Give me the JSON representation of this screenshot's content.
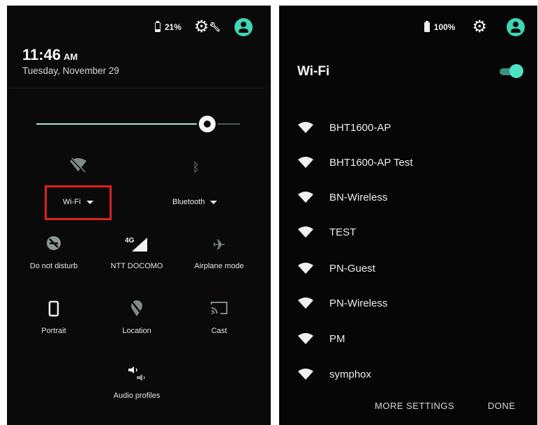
{
  "left_panel": {
    "status": {
      "battery_percent": "21%",
      "battery_level": 0.21
    },
    "clock": {
      "time": "11:46",
      "ampm": "AM"
    },
    "date": "Tuesday, November 29",
    "brightness_level": 0.84,
    "tiles": {
      "wifi": {
        "label": "Wi-Fi",
        "icon": "wifi-off-icon",
        "highlighted": true
      },
      "bluetooth": {
        "label": "Bluetooth",
        "icon": "bluetooth-off-icon"
      },
      "dnd": {
        "label": "Do not disturb",
        "icon": "do-not-disturb-icon"
      },
      "cellular": {
        "label": "NTT DOCOMO",
        "network_type": "4G",
        "icon": "signal-icon"
      },
      "airplane": {
        "label": "Airplane mode",
        "icon": "airplane-icon"
      },
      "rotation": {
        "label": "Portrait",
        "icon": "portrait-icon"
      },
      "location": {
        "label": "Location",
        "icon": "location-off-icon"
      },
      "cast": {
        "label": "Cast",
        "icon": "cast-icon"
      },
      "audio": {
        "label": "Audio profiles",
        "icon": "audio-profiles-icon"
      }
    },
    "colors": {
      "highlight_box": "#e02020",
      "accent": "#3dd6b8"
    }
  },
  "right_panel": {
    "status": {
      "battery_percent": "100%",
      "battery_level": 1.0
    },
    "title": "Wi-Fi",
    "wifi_enabled": true,
    "networks": [
      "BHT1600-AP",
      "BHT1600-AP Test",
      "BN-Wireless",
      "TEST",
      "PN-Guest",
      "PN-Wireless",
      "PM",
      "symphox"
    ],
    "actions": {
      "more_settings": "MORE SETTINGS",
      "done": "DONE"
    }
  }
}
